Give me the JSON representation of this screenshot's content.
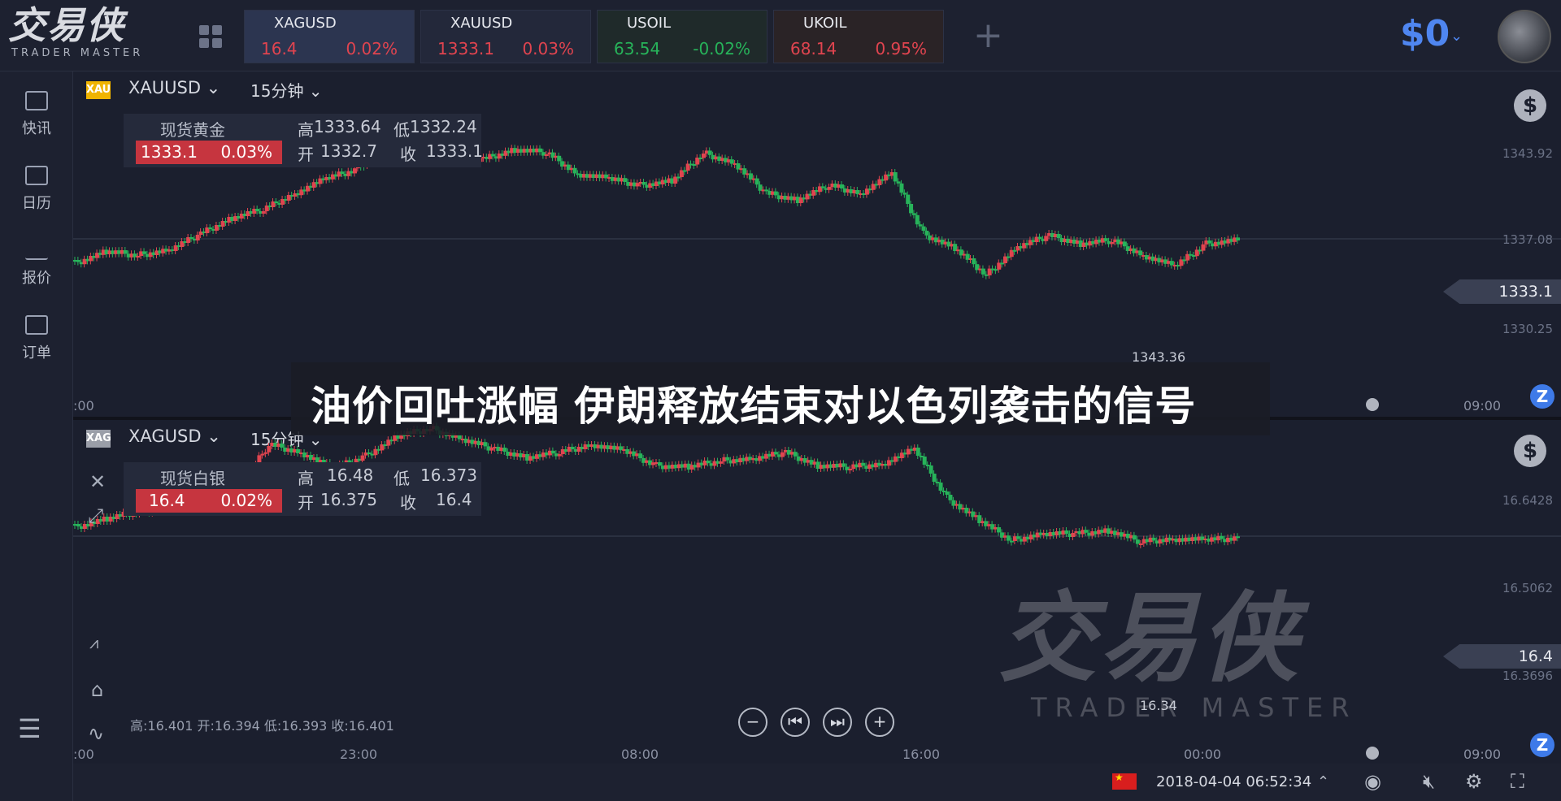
{
  "brand": {
    "name_cn": "交易侠",
    "name_en": "TRADER MASTER"
  },
  "tickers": [
    {
      "symbol": "XAGUSD",
      "price": "16.4",
      "change": "0.02%",
      "dir": "up",
      "active": true
    },
    {
      "symbol": "XAUUSD",
      "price": "1333.1",
      "change": "0.03%",
      "dir": "up",
      "active": false
    },
    {
      "symbol": "USOIL",
      "price": "63.54",
      "change": "-0.02%",
      "dir": "down",
      "active": false
    },
    {
      "symbol": "UKOIL",
      "price": "68.14",
      "change": "0.95%",
      "dir": "up",
      "active": false
    }
  ],
  "account": {
    "balance": "$0"
  },
  "sidebar": {
    "items": [
      {
        "label": "快讯",
        "icon": "news-icon"
      },
      {
        "label": "日历",
        "icon": "calendar-icon"
      },
      {
        "label": "报价",
        "icon": "quote-chart-icon"
      },
      {
        "label": "订单",
        "icon": "order-icon"
      }
    ]
  },
  "chart1": {
    "badge": "XAU",
    "symbol": "XAUUSD",
    "timeframe": "15分钟",
    "info": {
      "name": "现货黄金",
      "price": "1333.1",
      "change": "0.03%",
      "high_label": "高",
      "high": "1333.64",
      "low_label": "低",
      "low": "1332.24",
      "open_label": "开",
      "open": "1332.7",
      "close_label": "收",
      "close": "1333.1"
    },
    "y_ticks": [
      "1343.92",
      "1337.08",
      "1333.1",
      "1330.25"
    ],
    "last_price": "1333.1",
    "low_marker": "1343.36",
    "x_ticks": [
      ":00",
      "09:00"
    ]
  },
  "chart2": {
    "badge": "XAG",
    "symbol": "XAGUSD",
    "timeframe": "15分钟",
    "info": {
      "name": "现货白银",
      "price": "16.4",
      "change": "0.02%",
      "high_label": "高",
      "high": "16.48",
      "low_label": "低",
      "low": "16.373",
      "open_label": "开",
      "open": "16.375",
      "close_label": "收",
      "close": "16.4"
    },
    "y_ticks": [
      "16.6428",
      "16.5062",
      "16.3696"
    ],
    "last_price": "16.4",
    "low_marker": "16.34",
    "x_ticks": [
      ":00",
      "23:00",
      "08:00",
      "16:00",
      "00:00",
      "09:00"
    ],
    "ohlc_line": "高:16.401 开:16.394 低:16.393 收:16.401"
  },
  "headline": "油价回吐涨幅 伊朗释放结束对以色列袭击的信号",
  "status": {
    "datetime": "2018-04-04 06:52:34"
  },
  "colors": {
    "up": "#e0444f",
    "down": "#27b35a",
    "accent": "#4f86f0"
  }
}
